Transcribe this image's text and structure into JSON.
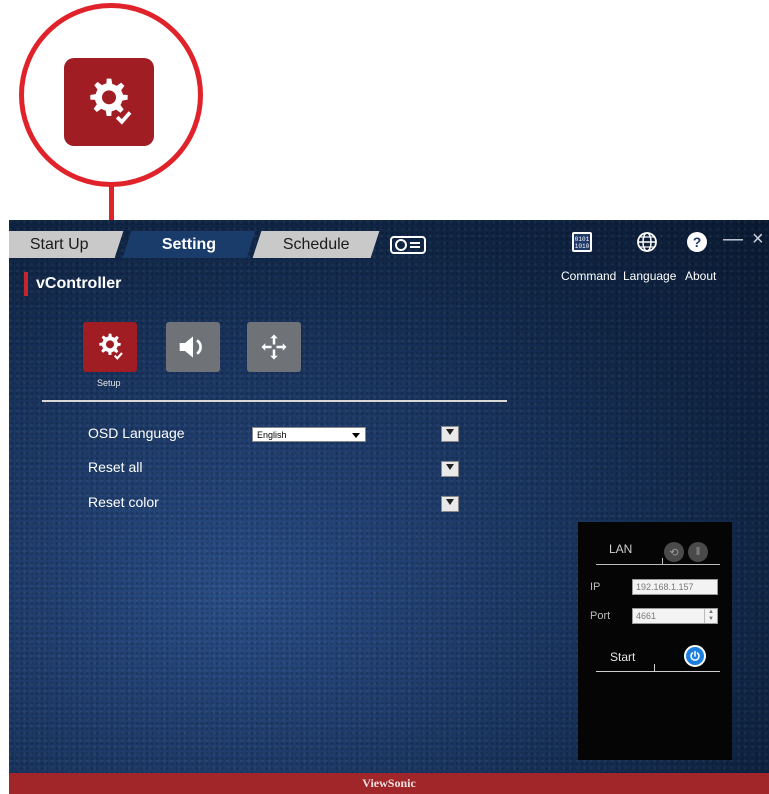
{
  "tabs": {
    "startup": "Start Up",
    "setting": "Setting",
    "schedule": "Schedule"
  },
  "brand": {
    "text": "vController"
  },
  "toolbar": {
    "command": "Command",
    "language": "Language",
    "about": "About"
  },
  "window_controls": {
    "minimize": "—",
    "close": "×"
  },
  "sub_nav": {
    "setup_label": "Setup"
  },
  "settings": {
    "osd_language_label": "OSD Language",
    "osd_language_value": "English",
    "reset_all_label": "Reset all",
    "reset_color_label": "Reset color"
  },
  "lan_panel": {
    "title": "LAN",
    "ip_label": "IP",
    "ip_value": "192.168.1.157",
    "port_label": "Port",
    "port_value": "4661",
    "start_label": "Start"
  },
  "footer": {
    "brand": "ViewSonic"
  },
  "icons": {
    "callout": "gear-icon",
    "projector": "projector-icon",
    "command": "binary-command-icon",
    "language": "globe-icon",
    "about": "help-icon",
    "setup": "gear-icon",
    "audio": "speaker-icon",
    "move": "move-arrows-icon",
    "lan_share": "share-icon",
    "lan_signal": "network-icon",
    "power": "power-icon"
  },
  "colors": {
    "accent_red": "#a11d24",
    "callout_red": "#e0232a",
    "active_tab": "#1a3c6b",
    "power_blue": "#1b7fe0"
  }
}
